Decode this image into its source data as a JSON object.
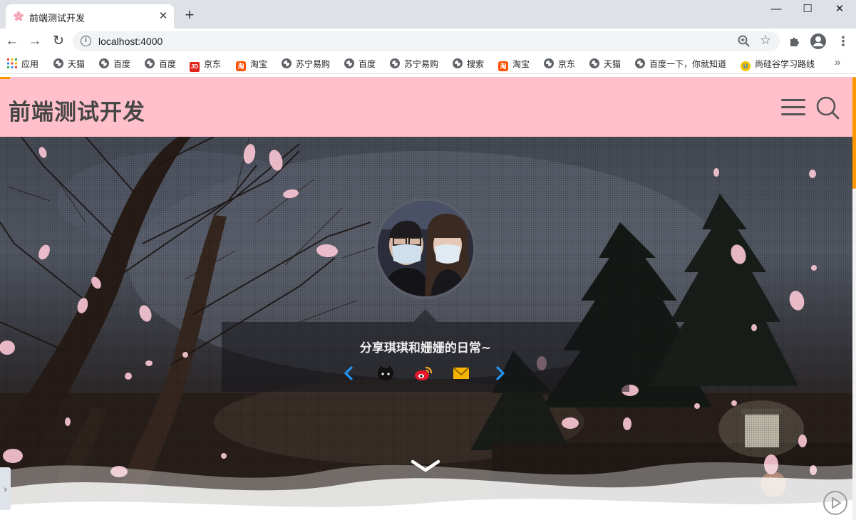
{
  "browser": {
    "tab_title": "前端测试开发",
    "url": "localhost:4000",
    "window_controls": {
      "minimize": "—",
      "maximize": "☐",
      "close": "✕"
    },
    "tab_close": "✕",
    "new_tab": "+",
    "nav": {
      "back": "←",
      "forward": "→",
      "reload": "↻"
    },
    "menu": "⋮",
    "bookmarks_more": "»",
    "bookmarks": [
      {
        "label": "应用",
        "icon": "apps-icon"
      },
      {
        "label": "天猫",
        "icon": "globe-icon"
      },
      {
        "label": "百度",
        "icon": "globe-icon"
      },
      {
        "label": "百度",
        "icon": "globe-icon"
      },
      {
        "label": "京东",
        "icon": "jd-icon"
      },
      {
        "label": "淘宝",
        "icon": "taobao-icon"
      },
      {
        "label": "苏宁易购",
        "icon": "globe-icon"
      },
      {
        "label": "百度",
        "icon": "globe-icon"
      },
      {
        "label": "苏宁易购",
        "icon": "globe-icon"
      },
      {
        "label": "搜索",
        "icon": "globe-icon"
      },
      {
        "label": "淘宝",
        "icon": "taobao-icon"
      },
      {
        "label": "京东",
        "icon": "globe-icon"
      },
      {
        "label": "天猫",
        "icon": "globe-icon"
      },
      {
        "label": "百度一下，你就知道",
        "icon": "globe-icon"
      },
      {
        "label": "尚硅谷学习路线",
        "icon": "atguigu-icon"
      }
    ]
  },
  "site": {
    "title": "前端测试开发",
    "header_color": "#ffc0cb",
    "accent_color": "#ff9800"
  },
  "hero": {
    "motto": "分享琪琪和姗姗的日常~",
    "social_icons": [
      "chevron-left-icon",
      "github-icon",
      "weibo-icon",
      "email-icon",
      "chevron-right-icon"
    ],
    "social_colors": {
      "chevron": "#2196f3",
      "github": "#111111",
      "weibo": "#e6162d",
      "email": "#f5b400"
    }
  }
}
